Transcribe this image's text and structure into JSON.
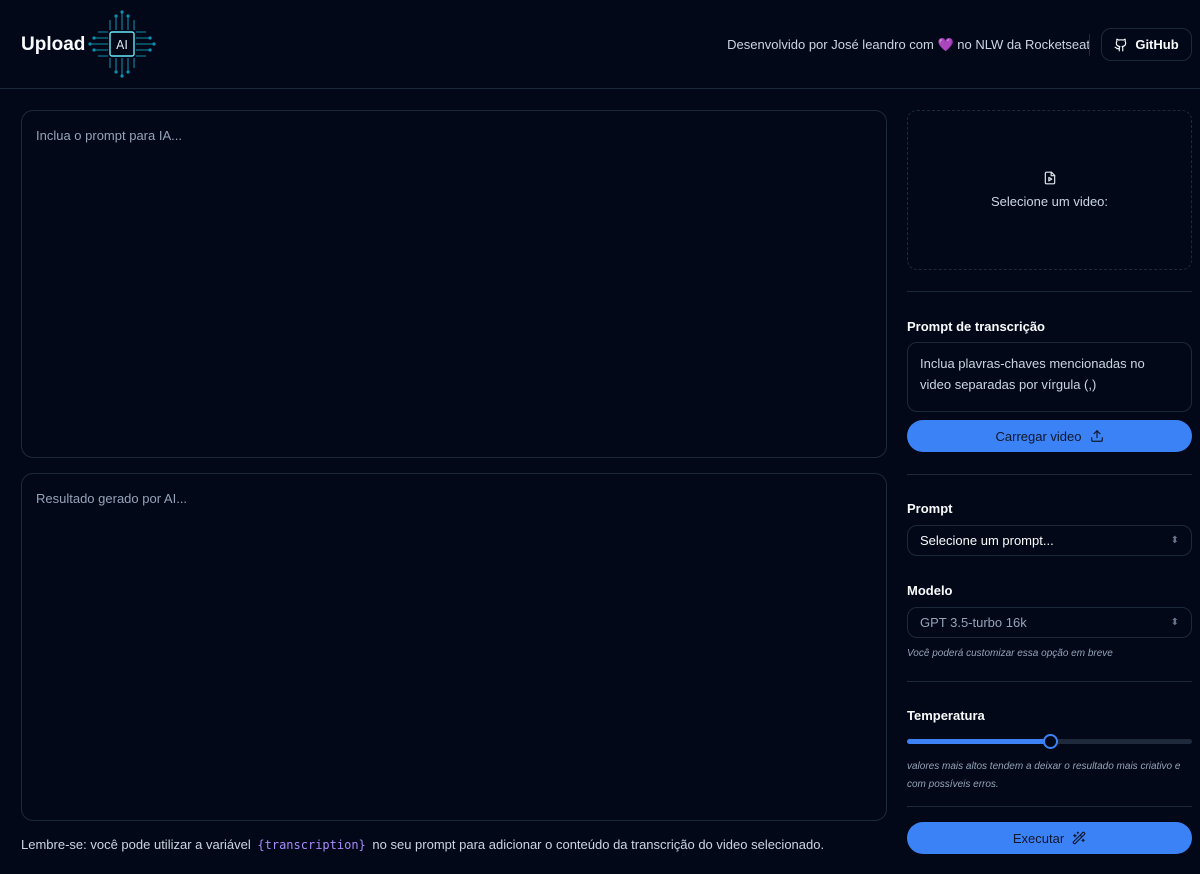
{
  "header": {
    "brand": "Upload",
    "logo_text": "AI",
    "credit_before": "Desenvolvido por José leandro com",
    "credit_heart": "💜",
    "credit_after": "no NLW da Rocketseat",
    "github_label": "GitHub"
  },
  "main": {
    "prompt_placeholder": "Inclua o prompt para IA...",
    "result_placeholder": "Resultado gerado por AI...",
    "footnote_before": "Lembre-se: você pode utilizar a variável",
    "footnote_code": "{transcription}",
    "footnote_after": "no seu prompt para adicionar o conteúdo da transcrição do video selecionado."
  },
  "sidebar": {
    "video_select_label": "Selecione um video:",
    "transcription_label": "Prompt de transcrição",
    "transcription_placeholder": "Inclua plavras-chaves mencionadas no video separadas por vírgula (,)",
    "upload_button": "Carregar video",
    "prompt_label": "Prompt",
    "prompt_select_value": "Selecione um prompt...",
    "model_label": "Modelo",
    "model_value": "GPT 3.5-turbo 16k",
    "model_hint": "Você poderá customizar essa opção em breve",
    "temperature_label": "Temperatura",
    "temperature_value": 0.5,
    "temperature_hint": "valores mais altos tendem a deixar o resultado mais criativo e com possíveis erros.",
    "execute_button": "Executar"
  },
  "colors": {
    "background": "#020817",
    "border": "#1e293b",
    "accent": "#3b82f6",
    "code": "#a78bfa"
  }
}
